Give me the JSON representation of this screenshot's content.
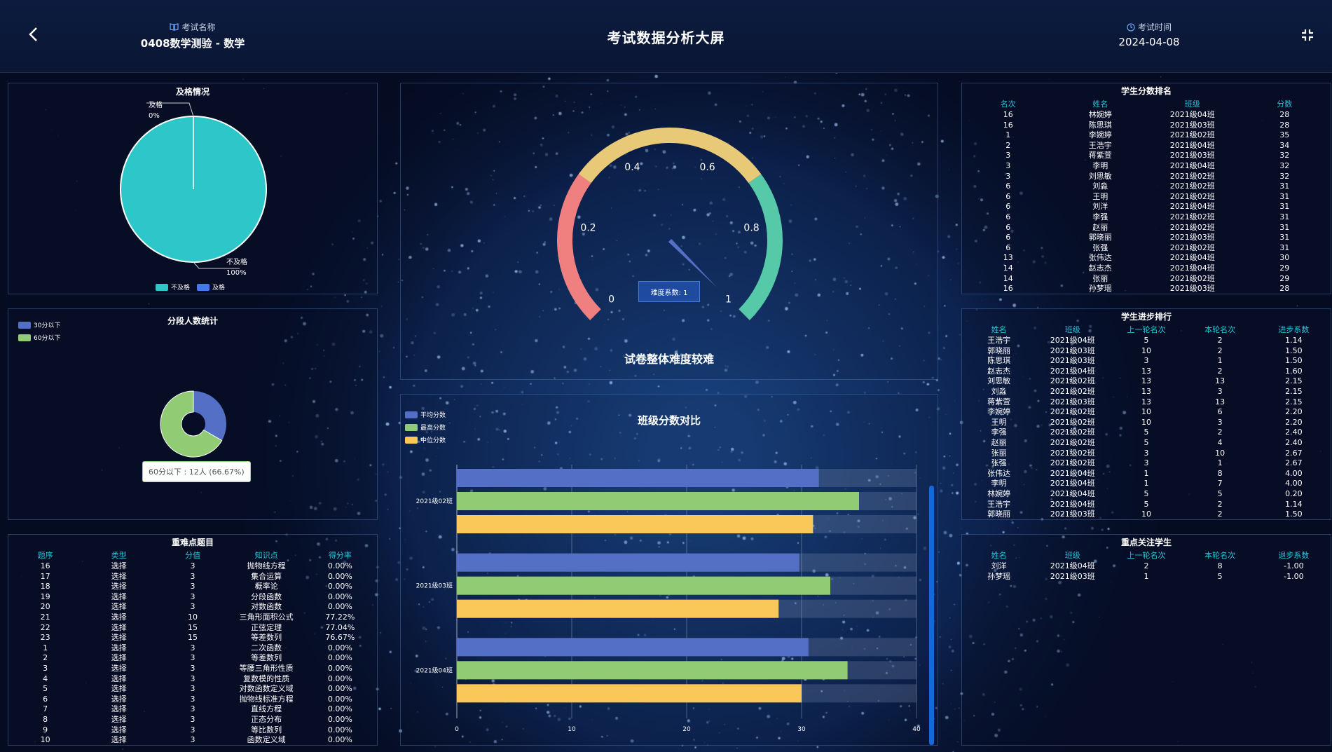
{
  "header": {
    "back_icon": "chevron-left-icon",
    "exam_name_label": "考试名称",
    "exam_name_icon": "book-icon",
    "exam_name_value": "0408数学测验 - 数学",
    "title": "考试数据分析大屏",
    "exam_time_label": "考试时间",
    "exam_time_icon": "clock-icon",
    "exam_time_value": "2024-04-08",
    "fullscreen_icon": "fullscreen-icon"
  },
  "pass": {
    "title": "及格情况",
    "label_pass": "及格",
    "label_pass_pct": "0%",
    "label_fail": "不及格",
    "label_fail_pct": "100%",
    "legend": [
      "不及格",
      "及格"
    ],
    "colors": {
      "fail": "#2ec7c9",
      "pass": "#4477f0"
    }
  },
  "segment": {
    "title": "分段人数统计",
    "legend": [
      "30分以下",
      "60分以下"
    ],
    "colors": [
      "#5470c6",
      "#91cc75"
    ],
    "tooltip": "60分以下 : 12人 (66.67%)"
  },
  "hard_questions": {
    "title": "重难点题目",
    "headers": [
      "题序",
      "类型",
      "分值",
      "知识点",
      "得分率"
    ],
    "rows": [
      [
        "16",
        "选择",
        "3",
        "抛物线方程",
        "0.00%"
      ],
      [
        "17",
        "选择",
        "3",
        "集合运算",
        "0.00%"
      ],
      [
        "18",
        "选择",
        "3",
        "概率论",
        "0.00%"
      ],
      [
        "19",
        "选择",
        "3",
        "分段函数",
        "0.00%"
      ],
      [
        "20",
        "选择",
        "3",
        "对数函数",
        "0.00%"
      ],
      [
        "21",
        "选择",
        "10",
        "三角形面积公式",
        "77.22%"
      ],
      [
        "22",
        "选择",
        "15",
        "正弦定理",
        "77.04%"
      ],
      [
        "23",
        "选择",
        "15",
        "等差数列",
        "76.67%"
      ],
      [
        "1",
        "选择",
        "3",
        "二次函数",
        "0.00%"
      ],
      [
        "2",
        "选择",
        "3",
        "等差数列",
        "0.00%"
      ],
      [
        "3",
        "选择",
        "3",
        "等腰三角形性质",
        "0.00%"
      ],
      [
        "4",
        "选择",
        "3",
        "复数模的性质",
        "0.00%"
      ],
      [
        "5",
        "选择",
        "3",
        "对数函数定义域",
        "0.00%"
      ],
      [
        "6",
        "选择",
        "3",
        "抛物线标准方程",
        "0.00%"
      ],
      [
        "7",
        "选择",
        "3",
        "直线方程",
        "0.00%"
      ],
      [
        "8",
        "选择",
        "3",
        "正态分布",
        "0.00%"
      ],
      [
        "9",
        "选择",
        "3",
        "等比数列",
        "0.00%"
      ],
      [
        "10",
        "选择",
        "3",
        "函数定义域",
        "0.00%"
      ]
    ]
  },
  "gauge": {
    "ticks": [
      "0",
      "0.2",
      "0.4",
      "0.6",
      "0.8",
      "1"
    ],
    "value": 1,
    "button": "难度系数: 1",
    "conclusion": "试卷整体难度较难",
    "colors": {
      "low": "#f08080",
      "mid": "#e8c978",
      "high": "#55c9a8",
      "pointer": "#5470c6"
    }
  },
  "chart_data": {
    "type": "bar",
    "title": "班级分数对比",
    "categories": [
      "2021级02班",
      "2021级03班",
      "2021级04班"
    ],
    "series": [
      {
        "name": "平均分数",
        "values": [
          31.5,
          29.8,
          30.6
        ],
        "color": "#5470c6"
      },
      {
        "name": "最高分数",
        "values": [
          35,
          32.5,
          34
        ],
        "color": "#91cc75"
      },
      {
        "name": "中位分数",
        "values": [
          31,
          28,
          30
        ],
        "color": "#fac858"
      }
    ],
    "xlim": [
      0,
      40
    ],
    "xticks": [
      "0",
      "10",
      "20",
      "30",
      "40"
    ],
    "grid": true,
    "legend_position": "top-left"
  },
  "ranking": {
    "title": "学生分数排名",
    "headers": [
      "名次",
      "姓名",
      "班级",
      "分数"
    ],
    "rows": [
      [
        "16",
        "林婉婷",
        "2021级04班",
        "28"
      ],
      [
        "16",
        "陈思琪",
        "2021级03班",
        "28"
      ],
      [
        "1",
        "李婉婷",
        "2021级02班",
        "35"
      ],
      [
        "2",
        "王浩宇",
        "2021级04班",
        "34"
      ],
      [
        "3",
        "蒋紫萱",
        "2021级03班",
        "32"
      ],
      [
        "3",
        "李明",
        "2021级04班",
        "32"
      ],
      [
        "3",
        "刘思敏",
        "2021级02班",
        "32"
      ],
      [
        "6",
        "刘淼",
        "2021级02班",
        "31"
      ],
      [
        "6",
        "王明",
        "2021级02班",
        "31"
      ],
      [
        "6",
        "刘洋",
        "2021级04班",
        "31"
      ],
      [
        "6",
        "李强",
        "2021级02班",
        "31"
      ],
      [
        "6",
        "赵丽",
        "2021级02班",
        "31"
      ],
      [
        "6",
        "郭晓丽",
        "2021级03班",
        "31"
      ],
      [
        "6",
        "张强",
        "2021级02班",
        "31"
      ],
      [
        "13",
        "张伟达",
        "2021级04班",
        "30"
      ],
      [
        "14",
        "赵志杰",
        "2021级04班",
        "29"
      ],
      [
        "14",
        "张丽",
        "2021级02班",
        "29"
      ],
      [
        "16",
        "孙梦瑶",
        "2021级03班",
        "28"
      ]
    ]
  },
  "progress": {
    "title": "学生进步排行",
    "headers": [
      "姓名",
      "班级",
      "上一轮名次",
      "本轮名次",
      "进步系数"
    ],
    "rows": [
      [
        "王浩宇",
        "2021级04班",
        "5",
        "2",
        "1.14"
      ],
      [
        "郭晓丽",
        "2021级03班",
        "10",
        "2",
        "1.50"
      ],
      [
        "陈思琪",
        "2021级03班",
        "3",
        "1",
        "1.50"
      ],
      [
        "赵志杰",
        "2021级04班",
        "13",
        "2",
        "1.60"
      ],
      [
        "刘思敏",
        "2021级02班",
        "13",
        "13",
        "2.15"
      ],
      [
        "刘淼",
        "2021级02班",
        "13",
        "3",
        "2.15"
      ],
      [
        "蒋紫萱",
        "2021级03班",
        "13",
        "13",
        "2.15"
      ],
      [
        "李婉婷",
        "2021级02班",
        "10",
        "6",
        "2.20"
      ],
      [
        "王明",
        "2021级02班",
        "10",
        "3",
        "2.20"
      ],
      [
        "李强",
        "2021级02班",
        "5",
        "2",
        "2.40"
      ],
      [
        "赵丽",
        "2021级02班",
        "5",
        "4",
        "2.40"
      ],
      [
        "张丽",
        "2021级02班",
        "3",
        "10",
        "2.67"
      ],
      [
        "张强",
        "2021级02班",
        "3",
        "1",
        "2.67"
      ],
      [
        "张伟达",
        "2021级04班",
        "1",
        "8",
        "4.00"
      ],
      [
        "李明",
        "2021级04班",
        "1",
        "7",
        "4.00"
      ],
      [
        "林婉婷",
        "2021级04班",
        "5",
        "5",
        "0.20"
      ],
      [
        "王浩宇",
        "2021级04班",
        "5",
        "2",
        "1.14"
      ],
      [
        "郭晓丽",
        "2021级03班",
        "10",
        "2",
        "1.50"
      ]
    ]
  },
  "focus": {
    "title": "重点关注学生",
    "headers": [
      "姓名",
      "班级",
      "上一轮名次",
      "本轮名次",
      "退步系数"
    ],
    "rows": [
      [
        "刘洋",
        "2021级04班",
        "2",
        "8",
        "-1.00"
      ],
      [
        "孙梦瑶",
        "2021级03班",
        "1",
        "5",
        "-1.00"
      ]
    ]
  }
}
